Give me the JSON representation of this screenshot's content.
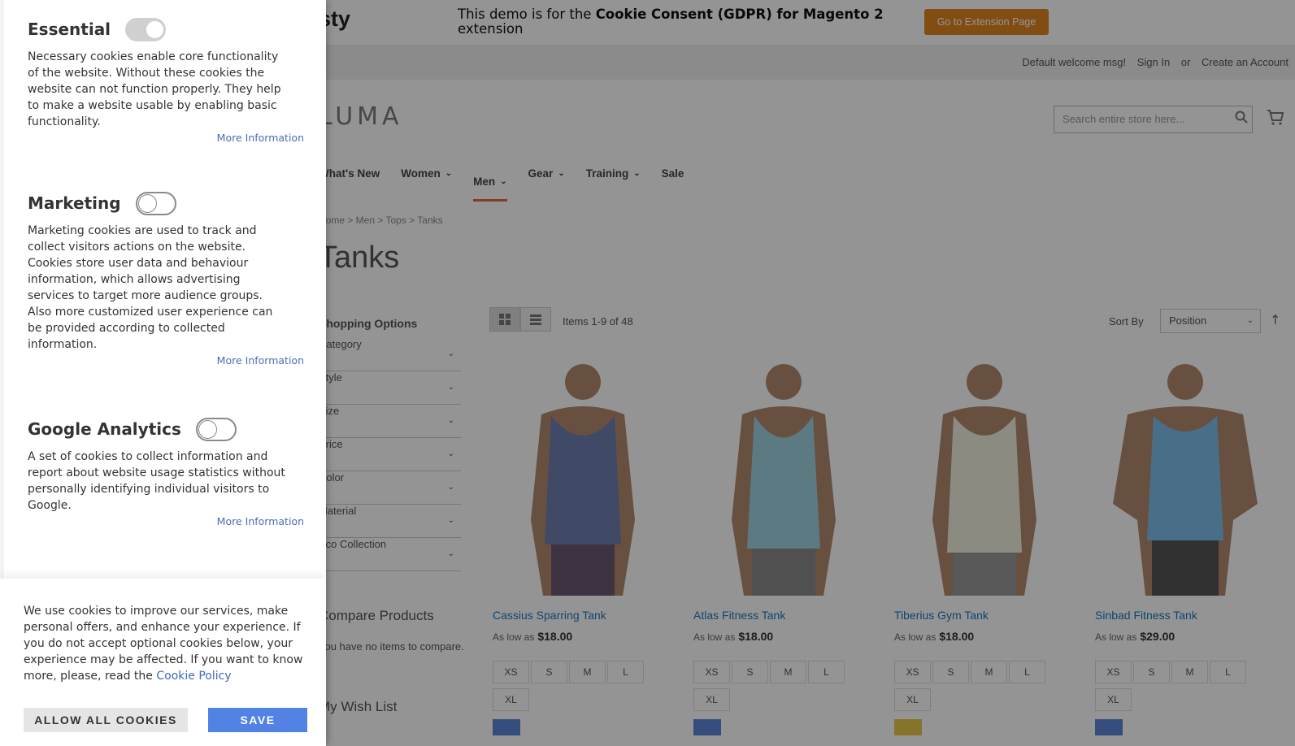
{
  "demo_bar": {
    "logo": "sty",
    "text_prefix": "This demo is for the ",
    "text_bold": "Cookie Consent (GDPR) for Magento 2",
    "text_suffix": " extension",
    "button_label": "Go to Extension Page",
    "button_color": "#e0861f"
  },
  "header": {
    "links": [
      "Default welcome msg!",
      "Sign In",
      "or",
      "Create an Account"
    ],
    "logo": "LUMA",
    "search_placeholder": "Search entire store here..."
  },
  "nav": {
    "items": [
      {
        "label": "What's New",
        "chevron": false
      },
      {
        "label": "Women",
        "chevron": true
      },
      {
        "label": "Men",
        "chevron": true,
        "active": true
      },
      {
        "label": "Gear",
        "chevron": true
      },
      {
        "label": "Training",
        "chevron": true
      },
      {
        "label": "Sale",
        "chevron": false
      }
    ]
  },
  "breadcrumb": "Home > Men > Tops > Tanks",
  "page_title": "Tanks",
  "sidebar": {
    "shop_by": "Shopping Options",
    "filters": [
      "Category",
      "Style",
      "Size",
      "Price",
      "Color",
      "Material",
      "Eco Collection"
    ],
    "compare_title": "Compare Products",
    "compare_text": "You have no items to compare.",
    "wishlist_title": "My Wish List"
  },
  "toolbar": {
    "items_count": "Items 1-9 of 48",
    "sort_label": "Sort By",
    "sort_value": "Position"
  },
  "products": [
    {
      "name": "Cassius Sparring Tank",
      "as_low_as": "As low as",
      "price": "$18.00",
      "sizes": [
        "XS",
        "S",
        "M",
        "L",
        "XL"
      ],
      "swatch": "#5b86d6"
    },
    {
      "name": "Atlas Fitness Tank",
      "as_low_as": "As low as",
      "price": "$18.00",
      "sizes": [
        "XS",
        "S",
        "M",
        "L",
        "XL"
      ],
      "swatch": "#5b86d6"
    },
    {
      "name": "Tiberius Gym Tank",
      "as_low_as": "As low as",
      "price": "$18.00",
      "sizes": [
        "XS",
        "S",
        "M",
        "L",
        "XL"
      ],
      "swatch": "#e8c84a"
    },
    {
      "name": "Sinbad Fitness Tank",
      "as_low_as": "As low as",
      "price": "$29.00",
      "sizes": [
        "XS",
        "S",
        "M",
        "L",
        "XL"
      ],
      "swatch": "#5b86d6"
    }
  ],
  "cookie_panel": {
    "groups": [
      {
        "title": "Essential",
        "toggle_on": true,
        "description": "Necessary cookies enable core functionality of the website. Without these cookies the website can not function properly. They help to make a website usable by enabling basic functionality.",
        "more_info": "More Information"
      },
      {
        "title": "Marketing",
        "toggle_on": false,
        "description": "Marketing cookies are used to track and collect visitors actions on the website. Cookies store user data and behaviour information, which allows advertising services to target more audience groups. Also more customized user experience can be provided according to collected information.",
        "more_info": "More Information"
      },
      {
        "title": "Google Analytics",
        "toggle_on": false,
        "description": "A set of cookies to collect information and report about website usage statistics without personally identifying individual visitors to Google.",
        "more_info": "More Information"
      }
    ],
    "notice_text": "We use cookies to improve our services, make personal offers, and enhance your experience. If you do not accept optional cookies below, your experience may be affected. If you want to know more, please, read the ",
    "policy_link": "Cookie Policy",
    "allow_all_label": "ALLOW ALL COOKIES",
    "save_label": "SAVE",
    "save_color": "#5283e4"
  }
}
